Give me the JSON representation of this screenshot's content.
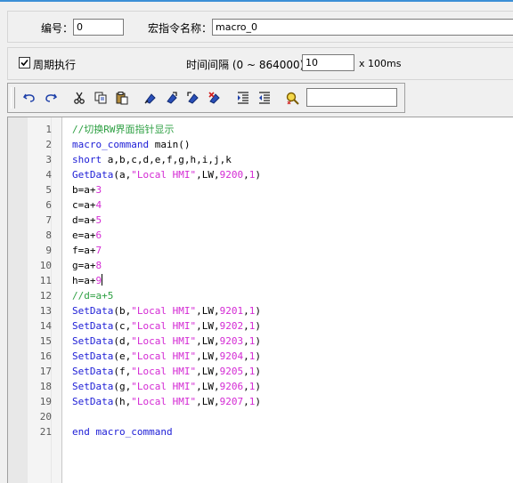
{
  "header": {
    "id_label": "编号：",
    "id_value": "0",
    "name_label": "宏指令名称：",
    "name_value": "macro_0"
  },
  "periodic": {
    "checkbox_label": "周期执行",
    "checked": true,
    "interval_label": "时间间隔 (0 ~ 864000)：",
    "interval_value": "10",
    "interval_unit": "x 100ms"
  },
  "toolbar": {
    "buttons": [
      "undo-icon",
      "redo-icon",
      "cut-icon",
      "copy-icon",
      "paste-icon",
      "toggle-bookmark-icon",
      "next-bookmark-icon",
      "previous-bookmark-icon",
      "clear-bookmarks-icon",
      "indent-icon",
      "outdent-icon",
      "find-icon"
    ],
    "search_value": ""
  },
  "editor": {
    "line_numbers": [
      "1",
      "2",
      "3",
      "4",
      "5",
      "6",
      "7",
      "8",
      "9",
      "10",
      "11",
      "12",
      "13",
      "14",
      "15",
      "16",
      "17",
      "18",
      "19",
      "20",
      "21"
    ],
    "lines": [
      "//切换RW界面指针显示",
      "macro_command main()",
      "short a,b,c,d,e,f,g,h,i,j,k",
      "GetData(a,\"Local HMI\",LW,9200,1)",
      "b=a+3",
      "c=a+4",
      "d=a+5",
      "e=a+6",
      "f=a+7",
      "g=a+8",
      "h=a+9",
      "//d=a+5",
      "SetData(b,\"Local HMI\",LW,9201,1)",
      "SetData(c,\"Local HMI\",LW,9202,1)",
      "SetData(d,\"Local HMI\",LW,9203,1)",
      "SetData(e,\"Local HMI\",LW,9204,1)",
      "SetData(f,\"Local HMI\",LW,9205,1)",
      "SetData(g,\"Local HMI\",LW,9206,1)",
      "SetData(h,\"Local HMI\",LW,9207,1)",
      "",
      "end macro_command"
    ]
  },
  "colors": {
    "keyword": "#1c1cd6",
    "comment": "#2ea043",
    "string_number": "#d42ad4",
    "accent": "#3c8fd6"
  }
}
